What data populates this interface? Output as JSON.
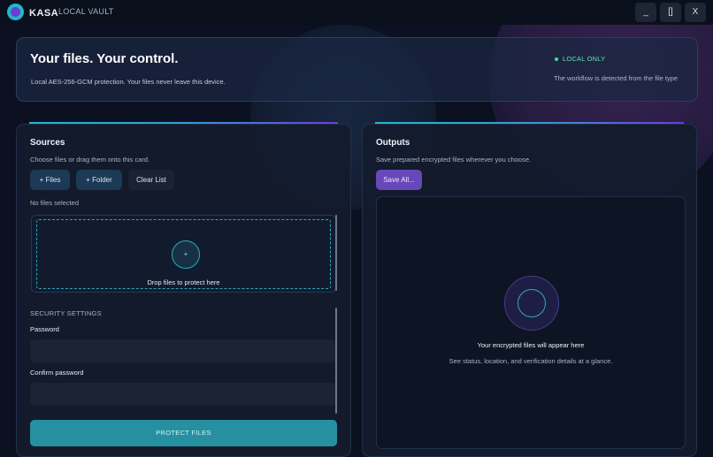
{
  "app": {
    "name": "KASA",
    "subtitle": "LOCAL VAULT",
    "controls": {
      "minimize": "_",
      "maximize": "[]",
      "close": "X"
    }
  },
  "hero": {
    "title": "Your files. Your control.",
    "description": "Local AES-256-GCM protection. Your files never leave this device.",
    "badge": "LOCAL ONLY",
    "note": "The workflow is detected from the file type"
  },
  "sources": {
    "title": "Sources",
    "subtitle": "Choose files or drag them onto this card.",
    "buttons": {
      "files": "+ Files",
      "folder": "+ Folder",
      "clear": "Clear List"
    },
    "status": "No files selected",
    "dropzone": {
      "icon": "+",
      "text": "Drop files to protect here"
    }
  },
  "settings": {
    "heading": "SECURITY SETTINGS",
    "password_label": "Password",
    "password_value": "",
    "confirm_label": "Confirm password",
    "confirm_value": "",
    "protect_button": "PROTECT FILES"
  },
  "outputs": {
    "title": "Outputs",
    "subtitle": "Save prepared encrypted files wherever you choose.",
    "save_button": "Save All...",
    "empty_title": "Your encrypted files will appear here",
    "empty_sub": "See status, location, and verification details at a glance."
  },
  "colors": {
    "accent_teal": "#22b8c8",
    "accent_purple": "#6b3cd6",
    "badge_green": "#3fe0a0",
    "background": "#0b1120"
  },
  "icons": [
    "logo-icon",
    "plus-icon",
    "status-dot-icon",
    "encrypted-files-icon"
  ]
}
